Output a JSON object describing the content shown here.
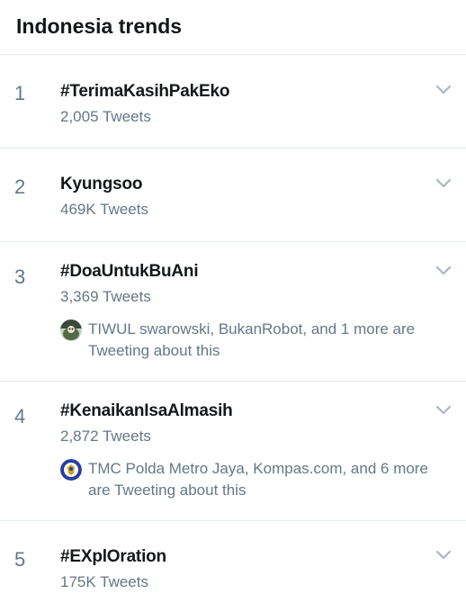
{
  "header": {
    "title": "Indonesia trends"
  },
  "trends": [
    {
      "rank": "1",
      "name": "#TerimaKasihPakEko",
      "count": "2,005 Tweets"
    },
    {
      "rank": "2",
      "name": "Kyungsoo",
      "count": "469K Tweets"
    },
    {
      "rank": "3",
      "name": "#DoaUntukBuAni",
      "count": "3,369 Tweets",
      "context": "TIWUL swarowski, BukanRobot, and 1 more are Tweeting about this",
      "avatar_icon": "user-avatar-photo"
    },
    {
      "rank": "4",
      "name": "#KenaikanIsaAlmasih",
      "count": "2,872 Tweets",
      "context": "TMC Polda Metro Jaya, Kompas.com, and 6 more are Tweeting about this",
      "avatar_icon": "police-emblem-avatar"
    },
    {
      "rank": "5",
      "name": "#EXplOration",
      "count": "175K Tweets"
    }
  ],
  "colors": {
    "text": "#14171a",
    "secondary": "#657786",
    "divider": "#e6ecf0",
    "chevron": "#aab8c2"
  }
}
